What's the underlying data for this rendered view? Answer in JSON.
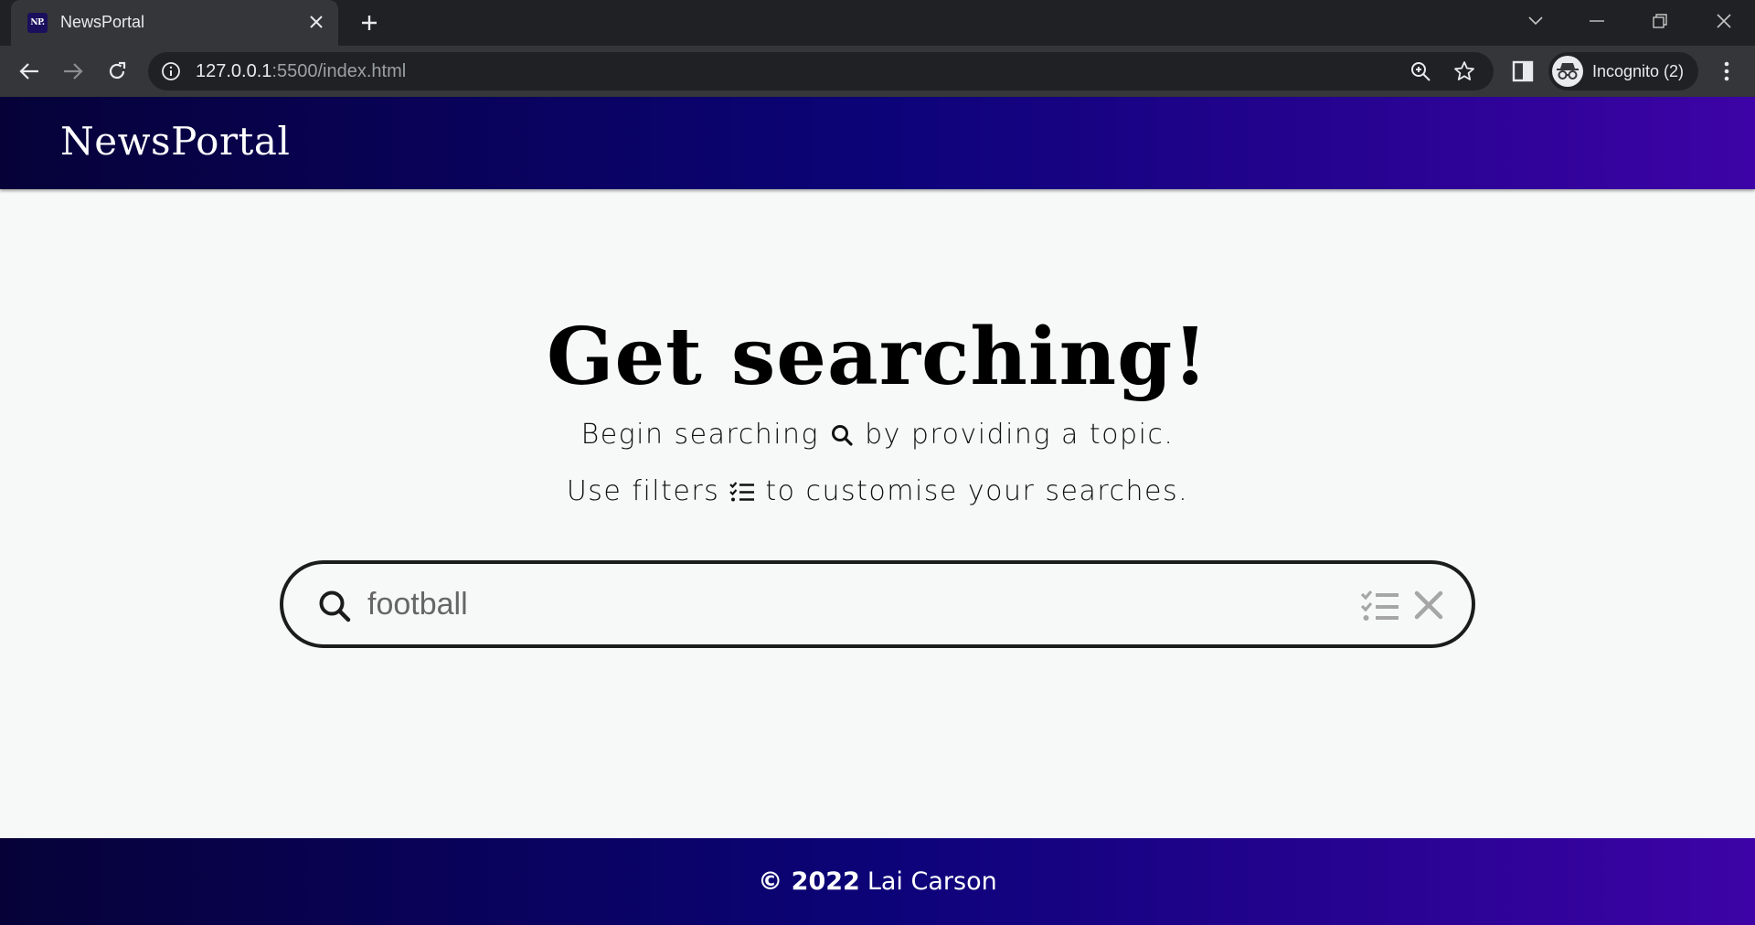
{
  "browser": {
    "tab_title": "NewsPortal",
    "favicon_text": "NP.",
    "url_host": "127.0.0.1",
    "url_rest": ":5500/index.html",
    "profile_label": "Incognito (2)"
  },
  "site": {
    "brand": "NewsPortal",
    "colors": {
      "header_start": "#060238",
      "header_mid": "#0c0378",
      "header_end": "#3d03a6",
      "page_bg": "#f7f9f8"
    }
  },
  "hero": {
    "title": "Get searching!",
    "line1_before": "Begin searching",
    "line1_after": "by providing a topic.",
    "line2_before": "Use filters",
    "line2_after": "to customise your searches."
  },
  "search": {
    "value": "football"
  },
  "footer": {
    "copyright": "© 2022",
    "author": "Lai Carson"
  }
}
